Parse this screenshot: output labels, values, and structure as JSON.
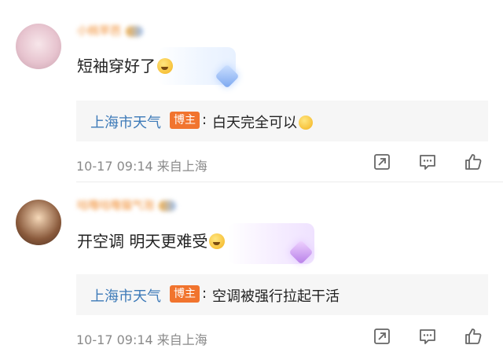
{
  "comments": [
    {
      "username": "小桃苹芭",
      "text": "短袖穿好了",
      "emoji": "grinning-sweat-emoji",
      "reply": {
        "author": "上海市天气",
        "tag": "博主",
        "colon": ":",
        "text": "白天完全可以",
        "emoji": "party-face-emoji"
      },
      "time": "10-17 09:14",
      "location": "来自上海"
    },
    {
      "username": "咕噜咕噜猫气泡",
      "text": "开空调 明天更难受",
      "emoji": "laughing-tears-emoji",
      "reply": {
        "author": "上海市天气",
        "tag": "博主",
        "colon": ":",
        "text": "空调被强行拉起干活",
        "emoji": ""
      },
      "time": "10-17 09:14",
      "location": "来自上海"
    }
  ],
  "icons": {
    "share": "share-icon",
    "comment": "comment-icon",
    "like": "thumbs-up-icon"
  },
  "colors": {
    "reply_author": "#3d7ab8",
    "author_tag": "#f1742e",
    "meta_text": "#8a8a8a"
  }
}
